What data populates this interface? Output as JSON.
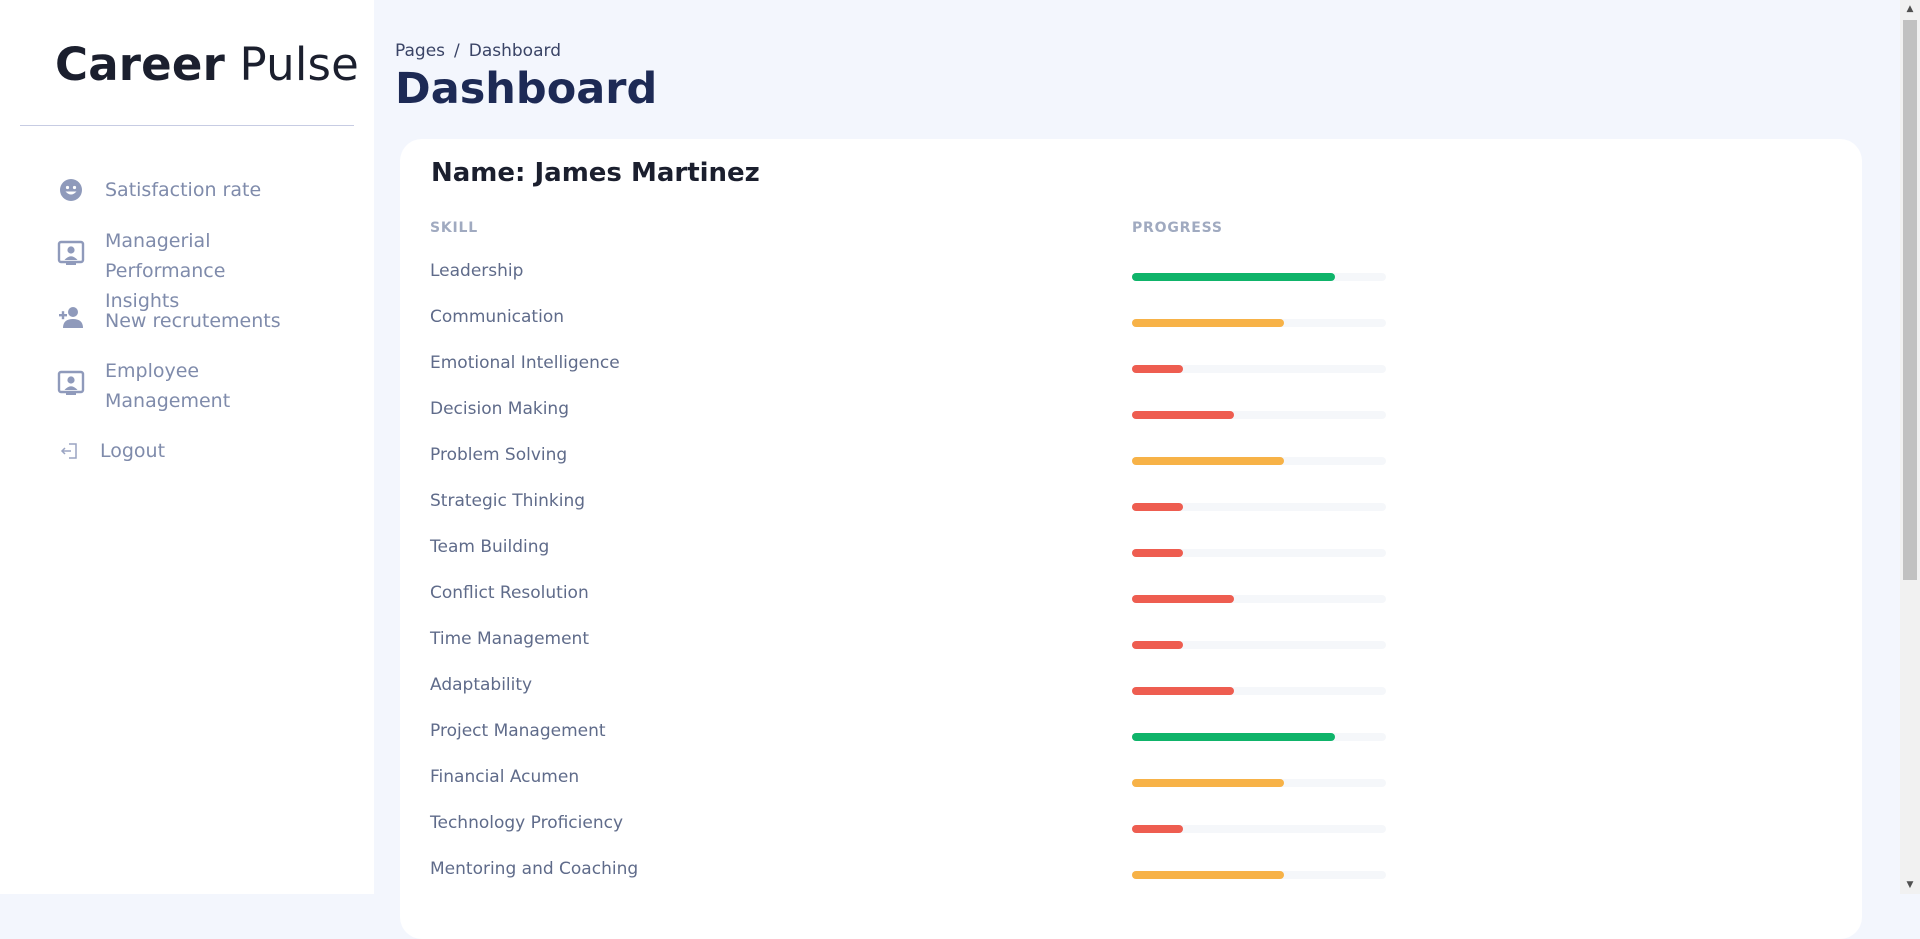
{
  "brand": {
    "bold": "Career",
    "light": "Pulse"
  },
  "sidebar": {
    "items": [
      {
        "label": "Satisfaction rate",
        "icon": "smiley-icon"
      },
      {
        "label": "Managerial Performance Insights",
        "icon": "presentation-user-icon"
      },
      {
        "label": "New recrutements",
        "icon": "user-plus-icon"
      },
      {
        "label": "Employee Management",
        "icon": "presentation-user-icon"
      },
      {
        "label": "Logout",
        "icon": "logout-icon"
      }
    ]
  },
  "breadcrumb": {
    "root": "Pages",
    "separator": "/",
    "current": "Dashboard"
  },
  "page": {
    "title": "Dashboard"
  },
  "card": {
    "name_prefix": "Name: ",
    "name": "James Martinez",
    "name_full": "Name: James Martinez",
    "headers": {
      "skill": "SKILL",
      "progress": "PROGRESS"
    },
    "skills": [
      {
        "skill": "Leadership",
        "progress": 80,
        "level": "high"
      },
      {
        "skill": "Communication",
        "progress": 60,
        "level": "medium"
      },
      {
        "skill": "Emotional Intelligence",
        "progress": 20,
        "level": "low"
      },
      {
        "skill": "Decision Making",
        "progress": 40,
        "level": "low"
      },
      {
        "skill": "Problem Solving",
        "progress": 60,
        "level": "medium"
      },
      {
        "skill": "Strategic Thinking",
        "progress": 20,
        "level": "low"
      },
      {
        "skill": "Team Building",
        "progress": 20,
        "level": "low"
      },
      {
        "skill": "Conflict Resolution",
        "progress": 40,
        "level": "low"
      },
      {
        "skill": "Time Management",
        "progress": 20,
        "level": "low"
      },
      {
        "skill": "Adaptability",
        "progress": 40,
        "level": "low"
      },
      {
        "skill": "Project Management",
        "progress": 80,
        "level": "high"
      },
      {
        "skill": "Financial Acumen",
        "progress": 60,
        "level": "medium"
      },
      {
        "skill": "Technology Proficiency",
        "progress": 20,
        "level": "low"
      },
      {
        "skill": "Mentoring and Coaching",
        "progress": 60,
        "level": "medium"
      }
    ]
  },
  "colors": {
    "high": "#0fb46a",
    "medium": "#f7b247",
    "low": "#ee5d50",
    "sidebar_text": "#7f8bab",
    "title": "#1d2a55"
  }
}
